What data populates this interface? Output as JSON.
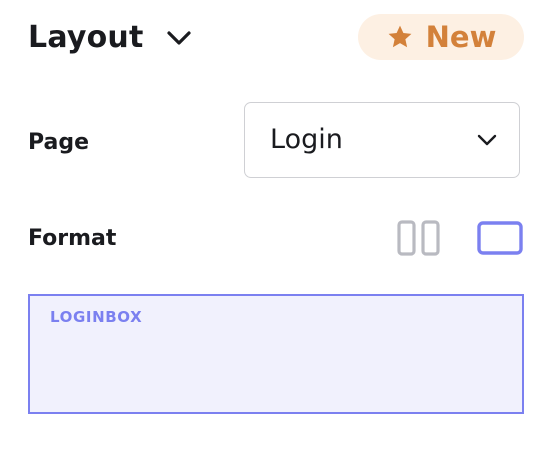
{
  "header": {
    "title": "Layout",
    "title_icon": "chevron-down-icon",
    "badge": {
      "label": "New",
      "icon": "star-icon",
      "color": "#d3813a",
      "background": "#fdf0e3"
    }
  },
  "page": {
    "label": "Page",
    "selected": "Login",
    "icon": "chevron-down-icon"
  },
  "format": {
    "label": "Format",
    "options": [
      {
        "name": "split",
        "icon": "two-column-layout-icon",
        "selected": false
      },
      {
        "name": "single",
        "icon": "single-box-layout-icon",
        "selected": true
      }
    ],
    "active_color": "#7b80f0",
    "inactive_color": "#b9bac1"
  },
  "canvas": {
    "box_label": "LOGINBOX",
    "accent": "#7b80f0",
    "fill": "#f1f1fd"
  }
}
